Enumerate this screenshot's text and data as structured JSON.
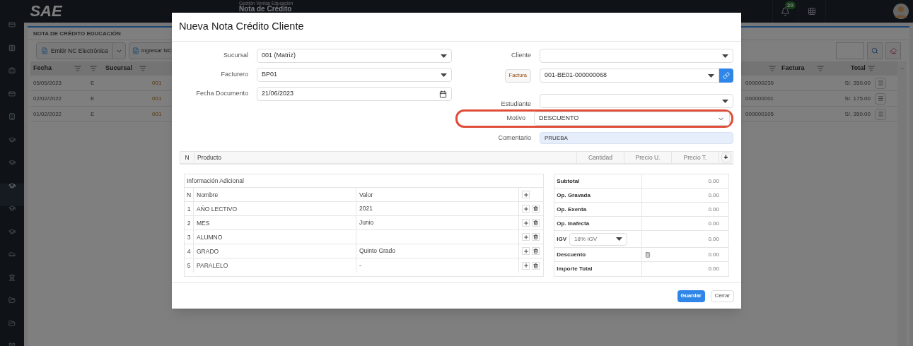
{
  "app": {
    "logo": "SAE",
    "module": "Gestión Ventas Educación",
    "page_title": "Nota de Crédito",
    "notifications": "20"
  },
  "sidebar": {
    "items": [
      {
        "kind": "card",
        "selected": false
      },
      {
        "kind": "table",
        "selected": false
      },
      {
        "kind": "briefcase",
        "selected": false
      },
      {
        "kind": "card",
        "selected": false
      },
      {
        "kind": "building",
        "selected": false
      },
      {
        "kind": "cap",
        "selected": false
      },
      {
        "kind": "cap",
        "selected": false
      },
      {
        "kind": "cap",
        "selected": true
      },
      {
        "kind": "cap",
        "selected": false
      },
      {
        "kind": "cap",
        "selected": false
      },
      {
        "kind": "car",
        "selected": false
      },
      {
        "kind": "bank",
        "selected": false
      },
      {
        "kind": "folder",
        "selected": false
      },
      {
        "kind": "folder",
        "selected": false
      },
      {
        "kind": "grid",
        "selected": false
      }
    ]
  },
  "panel": {
    "title": "NOTA DE CRÉDITO EDUCACIÓN",
    "toolbar": [
      "Emitir NC Electrónica",
      "Ingresar NC"
    ],
    "columns_left": [
      "Fecha",
      "Sucursal"
    ],
    "columns_right": [
      "Factura",
      "Total"
    ],
    "rows": [
      {
        "fecha": "05/05/2023",
        "tipo": "E",
        "sucursal": "001",
        "factura": "000000239",
        "total": "S/. 350.00"
      },
      {
        "fecha": "02/02/2022",
        "tipo": "E",
        "sucursal": "001",
        "factura": "000000001",
        "total": "S/. 175.00"
      },
      {
        "fecha": "01/02/2022",
        "tipo": "E",
        "sucursal": "001",
        "factura": "000000105",
        "total": "S/. 350.00"
      }
    ]
  },
  "dialog": {
    "title": "Nueva Nota Crédito Cliente",
    "left_fields": [
      {
        "label": "Sucursal",
        "value": "001 (Matriz)",
        "kind": "select"
      },
      {
        "label": "Facturero",
        "value": "BP01",
        "kind": "select"
      },
      {
        "label": "Fecha Documento",
        "value": "21/06/2023",
        "kind": "date"
      }
    ],
    "cliente": {
      "label": "Cliente"
    },
    "factura": {
      "button": "Factura",
      "value": "001-BE01-000000068"
    },
    "estudiante": {
      "label": "Estudiante"
    },
    "motivo": {
      "label": "Motivo",
      "value": "DESCUENTO",
      "highlighted": true
    },
    "comentario": {
      "label": "Comentario",
      "value": "PRUEBA"
    },
    "products": {
      "columns": [
        "N",
        "Producto",
        "Cantidad",
        "Precio U.",
        "Precio T."
      ],
      "add": "+"
    },
    "info": {
      "title": "Información Adicional",
      "columns": [
        "N",
        "Nombre",
        "Valor"
      ],
      "rows": [
        {
          "n": "1",
          "name": "AÑO LECTIVO",
          "value": "2021"
        },
        {
          "n": "2",
          "name": "MES",
          "value": "Junio"
        },
        {
          "n": "3",
          "name": "ALUMNO"
        },
        {
          "n": "4",
          "name": "GRADO",
          "value": "Quinto Grado"
        },
        {
          "n": "5",
          "name": "PARALELO",
          "value": "-"
        }
      ]
    },
    "totals": [
      {
        "label": "Subtotal",
        "value": "0.00",
        "kind": "plain"
      },
      {
        "label": "Op. Gravada",
        "value": "0.00",
        "kind": "plain"
      },
      {
        "label": "Op. Exenta",
        "value": "0.00",
        "kind": "plain"
      },
      {
        "label": "Op. Inafecta",
        "value": "0.00",
        "kind": "plain"
      },
      {
        "label": "IGV",
        "value": "0.00",
        "kind": "select",
        "option": "18% IGV"
      },
      {
        "label": "Descuento",
        "value": "0.00",
        "kind": "calc"
      },
      {
        "label": "Importe Total",
        "value": "0.00",
        "kind": "plain"
      }
    ],
    "buttons": [
      {
        "label": "Guardar",
        "primary": true
      },
      {
        "label": "Cerrar",
        "primary": false
      }
    ]
  }
}
